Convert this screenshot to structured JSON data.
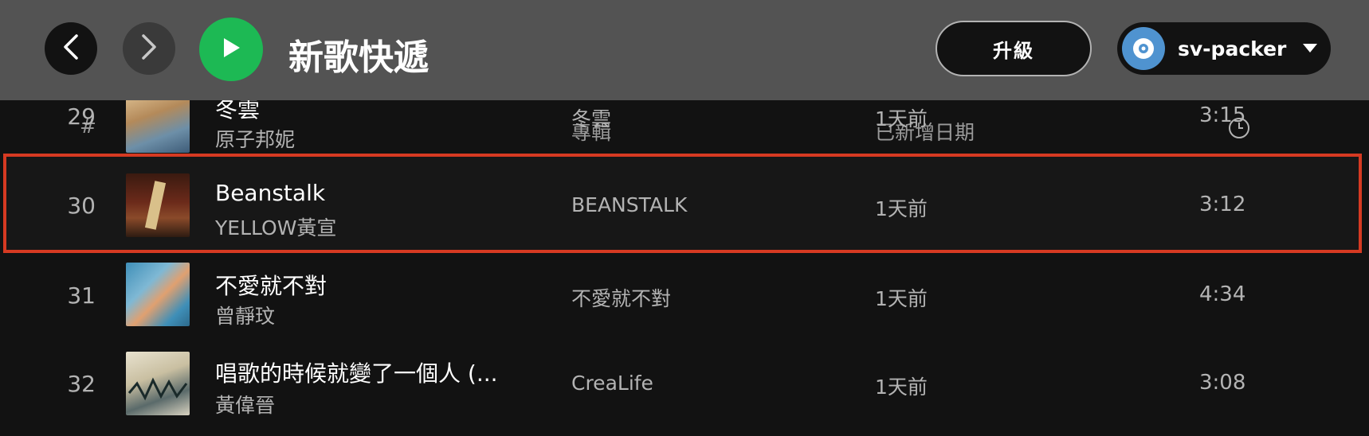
{
  "header": {
    "title": "新歌快遞",
    "upgrade_label": "升級",
    "username": "sv-packer"
  },
  "columns": {
    "number": "#",
    "album": "專輯",
    "date_added": "已新增日期"
  },
  "tracks": [
    {
      "number": "29",
      "title": "冬雲",
      "artist": "原子邦妮",
      "album": "冬雲",
      "added": "1天前",
      "duration": "3:15"
    },
    {
      "number": "30",
      "title": "Beanstalk",
      "artist": "YELLOW黃宣",
      "album": "BEANSTALK",
      "added": "1天前",
      "duration": "3:12"
    },
    {
      "number": "31",
      "title": "不愛就不對",
      "artist": "曾靜玟",
      "album": "不愛就不對",
      "added": "1天前",
      "duration": "4:34"
    },
    {
      "number": "32",
      "title": "唱歌的時候就變了一個人 (...",
      "artist": "黃偉晉",
      "album": "CreaLife",
      "added": "1天前",
      "duration": "3:08"
    }
  ],
  "icons": {
    "back": "chevron-left-icon",
    "forward": "chevron-right-icon",
    "play": "play-icon",
    "duration": "clock-icon",
    "user_menu": "caret-down-icon"
  },
  "colors": {
    "accent": "#1db954",
    "highlight_border": "#d63a22",
    "avatar": "#4f93d0"
  }
}
